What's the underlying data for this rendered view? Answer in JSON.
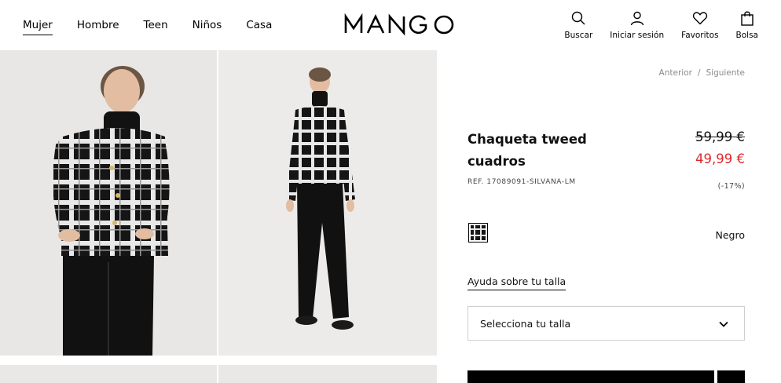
{
  "nav": {
    "items": [
      {
        "label": "Mujer",
        "active": true
      },
      {
        "label": "Hombre"
      },
      {
        "label": "Teen"
      },
      {
        "label": "Niños"
      },
      {
        "label": "Casa"
      }
    ]
  },
  "brand": {
    "logo_text": "MANGO"
  },
  "header_actions": [
    {
      "label": "Buscar",
      "icon": "search-icon"
    },
    {
      "label": "Iniciar sesión",
      "icon": "user-icon"
    },
    {
      "label": "Favoritos",
      "icon": "heart-icon"
    },
    {
      "label": "Bolsa",
      "icon": "bag-icon"
    }
  ],
  "pager": {
    "prev": "Anterior",
    "separator": "/",
    "next": "Siguiente"
  },
  "product": {
    "title": "Chaqueta tweed cuadros",
    "price_old": "59,99 €",
    "price_new": "49,99 €",
    "reference": "REF. 17089091-SILVANA-LM",
    "discount": "(-17%)",
    "color_name": "Negro",
    "size_help": "Ayuda sobre tu talla",
    "size_select_placeholder": "Selecciona tu talla"
  },
  "colors": {
    "sale_price": "#e0262b",
    "accent": "#000000",
    "muted_text": "#8a8a8a"
  }
}
